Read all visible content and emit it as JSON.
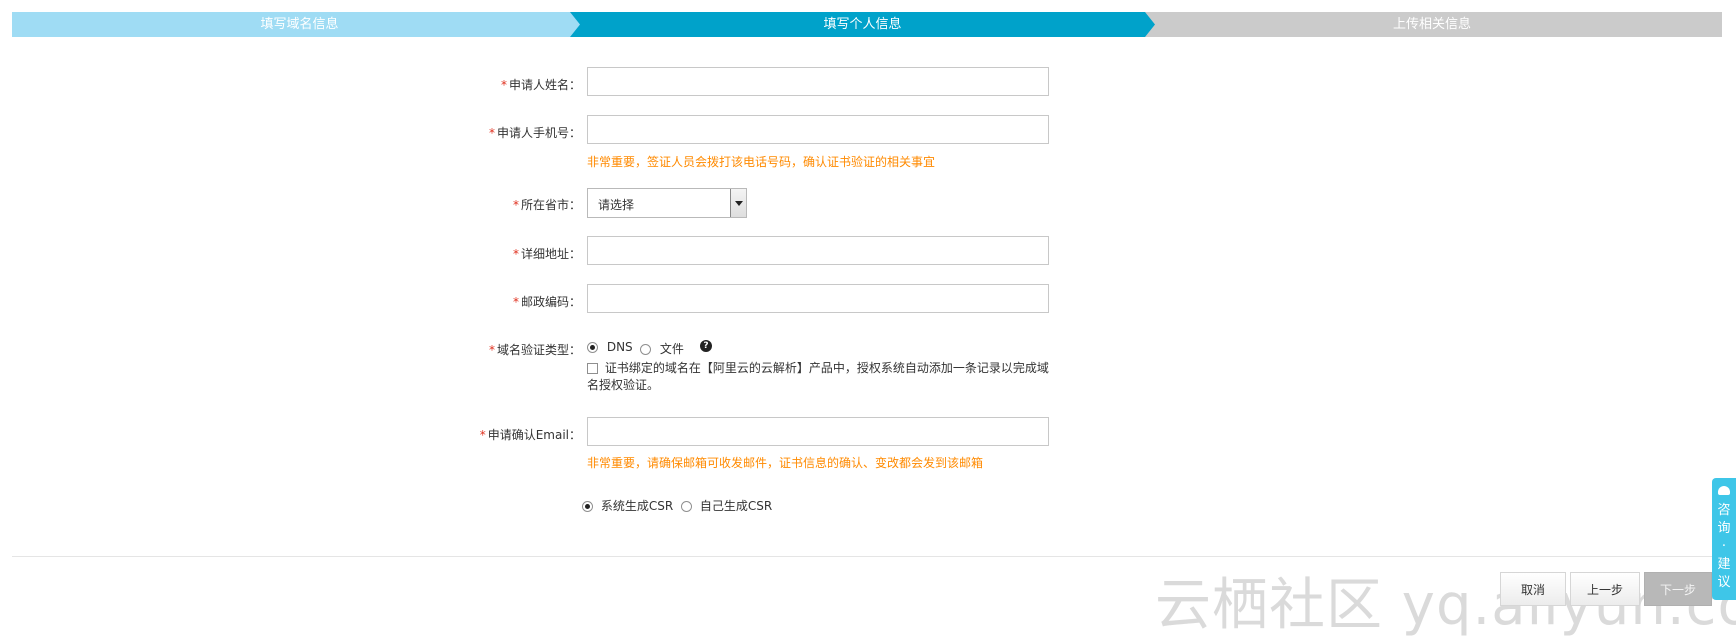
{
  "steps": [
    "填写域名信息",
    "填写个人信息",
    "上传相关信息"
  ],
  "form": {
    "required_mark": "*",
    "applicant_name": {
      "label": "申请人姓名：",
      "value": ""
    },
    "applicant_phone": {
      "label": "申请人手机号：",
      "value": "",
      "hint": "非常重要，签证人员会拨打该电话号码，确认证书验证的相关事宜"
    },
    "province": {
      "label": "所在省市：",
      "selected": "请选择"
    },
    "address": {
      "label": "详细地址：",
      "value": ""
    },
    "postcode": {
      "label": "邮政编码：",
      "value": ""
    },
    "verify_type": {
      "label": "域名验证类型：",
      "options": [
        "DNS",
        "文件"
      ],
      "selected": "DNS",
      "help_glyph": "?",
      "auth_note": "证书绑定的域名在【阿里云的云解析】产品中，授权系统自动添加一条记录以完成域名授权验证。",
      "auth_checked": false
    },
    "email": {
      "label": "申请确认Email：",
      "value": "",
      "hint": "非常重要，请确保邮箱可收发邮件，证书信息的确认、变改都会发到该邮箱"
    },
    "csr": {
      "options": [
        "系统生成CSR",
        "自己生成CSR"
      ],
      "selected": "系统生成CSR"
    }
  },
  "buttons": {
    "cancel": "取消",
    "prev": "上一步",
    "next": "下一步"
  },
  "watermark": "云栖社区 yq.aliyun.com",
  "side_tab": {
    "text": "咨\n询\n·\n建\n议"
  },
  "colors": {
    "step_done": "#9fdcf4",
    "step_active": "#00a2ca",
    "step_todo": "#cbcbcb",
    "hint": "#ff8a00",
    "required": "#e0301e",
    "side_tab": "#3ec6e8"
  }
}
